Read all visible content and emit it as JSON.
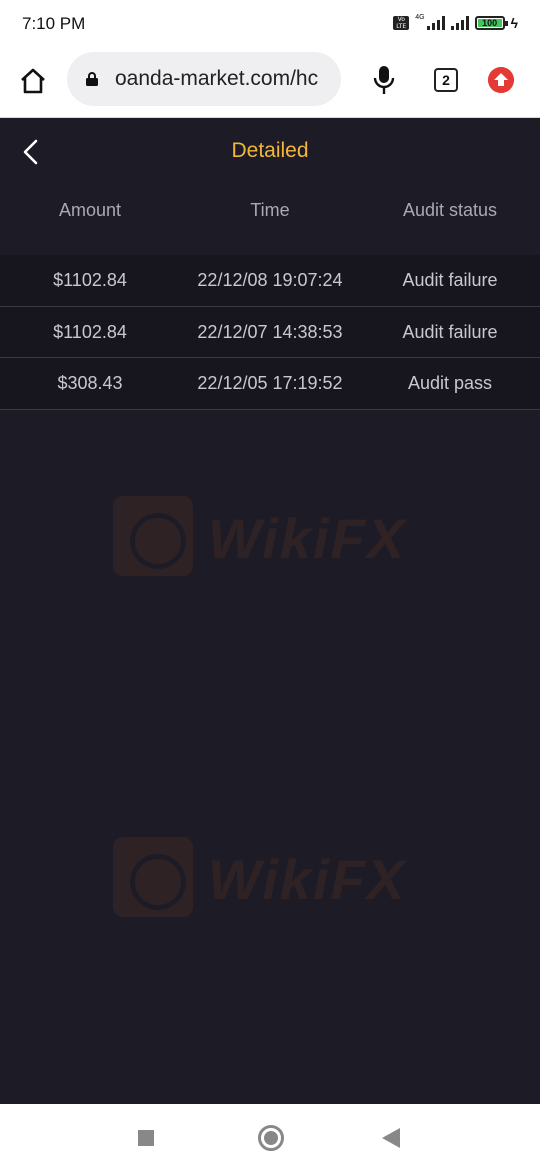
{
  "status_bar": {
    "time": "7:10 PM",
    "volte_label": "Vo LTE",
    "network_label": "4G",
    "battery_level": "100"
  },
  "browser": {
    "url": "oanda-market.com/hc",
    "tab_count": "2"
  },
  "page": {
    "title": "Detailed",
    "title_color": "#f2b73a"
  },
  "table": {
    "columns": [
      "Amount",
      "Time",
      "Audit status"
    ],
    "rows": [
      {
        "amount": "$1102.84",
        "time": "22/12/08 19:07:24",
        "status": "Audit failure"
      },
      {
        "amount": "$1102.84",
        "time": "22/12/07 14:38:53",
        "status": "Audit failure"
      },
      {
        "amount": "$308.43",
        "time": "22/12/05 17:19:52",
        "status": "Audit pass"
      }
    ]
  },
  "watermark": {
    "text": "WikiFX"
  },
  "icons": {
    "home": "home-icon",
    "lock": "lock-icon",
    "mic": "microphone-icon",
    "tabs": "tabs-icon",
    "update": "update-arrow-icon",
    "back": "chevron-left-icon",
    "nav_recent": "square-icon",
    "nav_home": "circle-icon",
    "nav_back": "triangle-back-icon"
  }
}
